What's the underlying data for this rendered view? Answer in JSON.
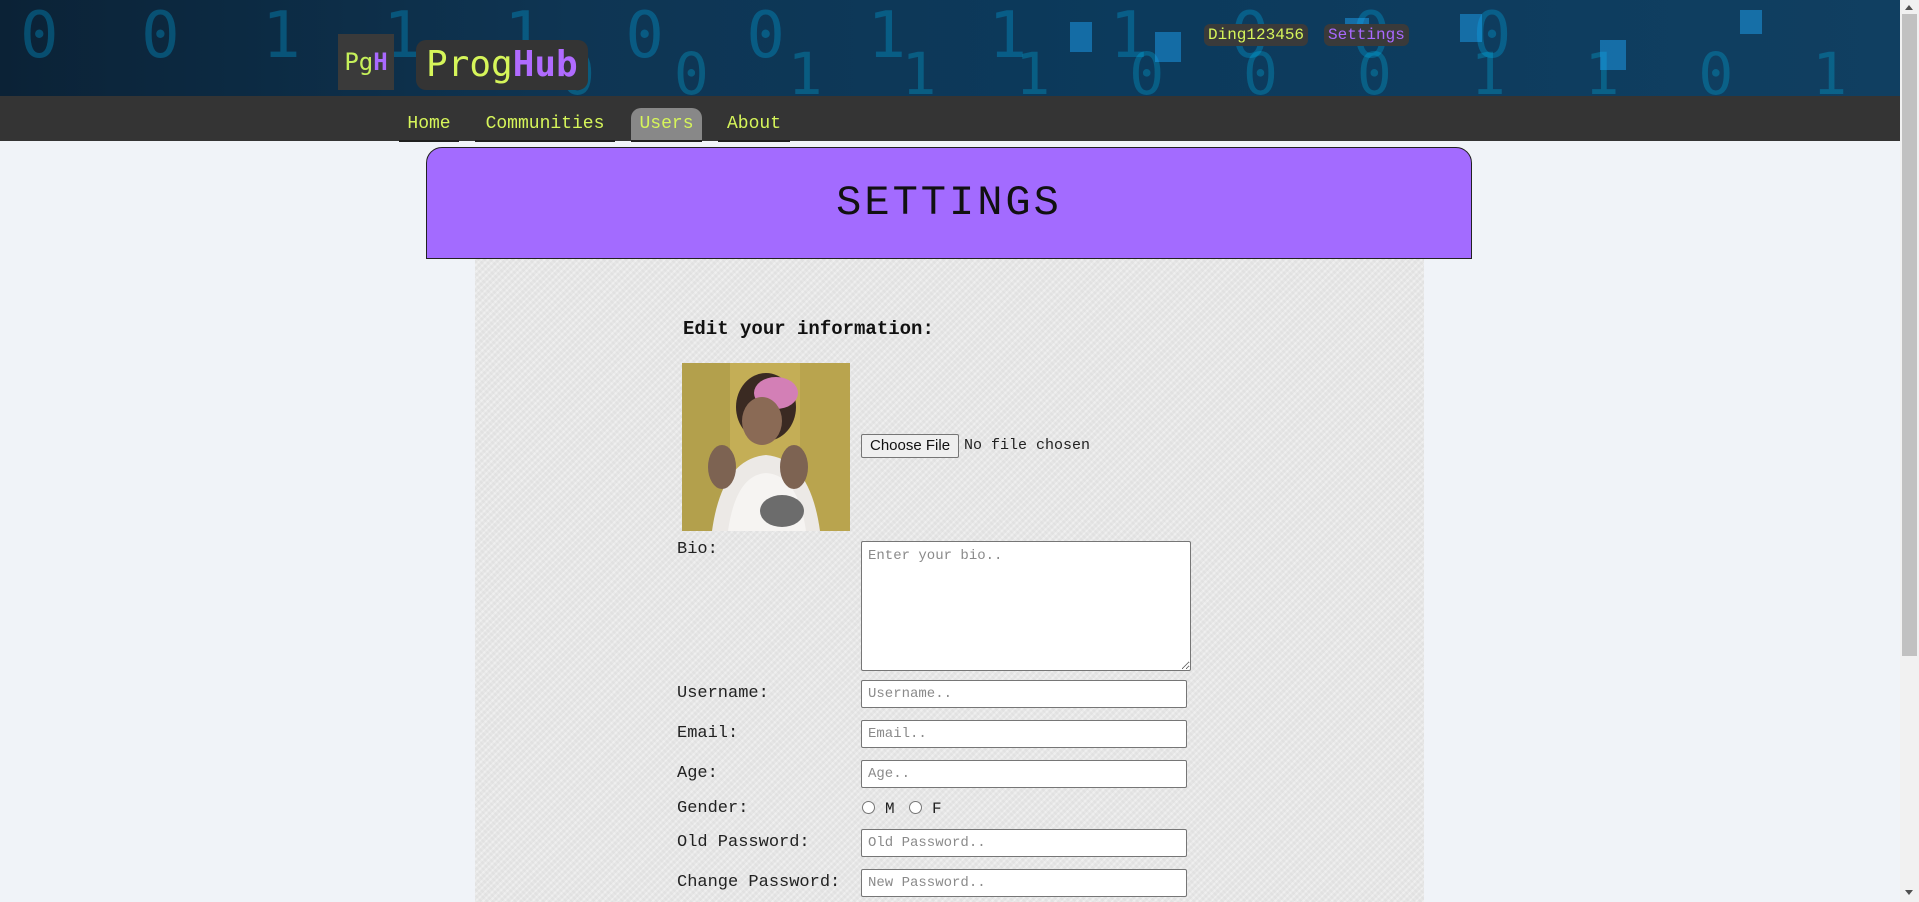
{
  "header": {
    "logo_square": {
      "left": "Pg",
      "right": "H"
    },
    "logo_text": {
      "left": "Prog",
      "right": "Hub"
    },
    "username": "Ding123456",
    "settings_link": "Settings",
    "background_digits_row1": "0 0 1 1 1 0 0 1 1 1 0 0 0",
    "background_digits_row2": "0 0 1 1 1 0 0 0 1 1 0 1 1 0 1 1 1 0"
  },
  "nav": {
    "items": [
      {
        "label": "Home"
      },
      {
        "label": "Communities"
      },
      {
        "label": "Users",
        "active": true
      },
      {
        "label": "About"
      }
    ]
  },
  "page": {
    "title": "SETTINGS",
    "form_title": "Edit your information:",
    "file_input": {
      "button": "Choose File",
      "status": "No file chosen"
    },
    "bio": {
      "label": "Bio:",
      "placeholder": "Enter your bio.."
    },
    "username": {
      "label": "Username:",
      "placeholder": "Username.."
    },
    "email": {
      "label": "Email:",
      "placeholder": "Email.."
    },
    "age": {
      "label": "Age:",
      "placeholder": "Age.."
    },
    "gender": {
      "label": "Gender:",
      "options": [
        "M",
        "F"
      ]
    },
    "old_password": {
      "label": "Old Password:",
      "placeholder": "Old Password.."
    },
    "new_password": {
      "label": "Change Password:",
      "placeholder": "New Password.."
    }
  },
  "colors": {
    "accent_purple": "#a36bff",
    "accent_lime": "#d6f55a",
    "nav_bg": "#343434",
    "page_bg": "#f0f3f8"
  }
}
